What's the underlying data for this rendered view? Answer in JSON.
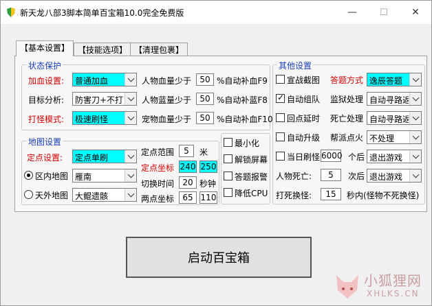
{
  "window": {
    "title": "新天龙八部3脚本简单百宝箱10.0完全免费版",
    "minimize": "—",
    "maximize": "☐",
    "close": "✕"
  },
  "tabs": [
    {
      "label": "【基本设置】",
      "active": true
    },
    {
      "label": "【技能选项】",
      "active": false
    },
    {
      "label": "【清理包裹】",
      "active": false
    }
  ],
  "status_protect": {
    "title": "状态保护",
    "rows": [
      {
        "label": "加血设置:",
        "combo": "普通加血",
        "desc": "人物血量少于",
        "value": "50",
        "suffix": "%自动补血F9"
      },
      {
        "label": "目标分析:",
        "combo": "防害刀+不打对",
        "desc": "人物蓝量少于",
        "value": "50",
        "suffix": "%自动补蓝F8"
      },
      {
        "label": "打怪模式:",
        "combo": "极速刷怪",
        "desc": "宠物血量少于",
        "value": "50",
        "suffix": "%自动补血F10"
      }
    ]
  },
  "map_settings": {
    "title": "地图设置",
    "point_label": "定点设置:",
    "point_combo": "定点单刷",
    "range_label": "定点范围",
    "range_value": "5",
    "range_unit": "米",
    "coord_label": "定点坐标",
    "coord_x": "240",
    "coord_y": "250",
    "switch_label": "切换时间",
    "switch_value": "20",
    "switch_unit": "秒钟",
    "two_label": "两点坐标",
    "two_x": "65",
    "two_y": "110",
    "inner_map_label": "区内地图",
    "inner_map_combo": "雁南",
    "outer_map_label": "天外地图",
    "outer_map_combo": "大鲲遗骸"
  },
  "misc_checks": [
    "最小化",
    "解锁屏幕",
    "答题报警",
    "降低CPU"
  ],
  "other_settings": {
    "title": "其他设置",
    "rows": [
      {
        "check": "宣战截图",
        "checked": false,
        "label": "答题方式",
        "label_red": true,
        "combo": "逸辰答题",
        "combo_cyan": true
      },
      {
        "check": "自动组队",
        "checked": true,
        "label": "监狱处理",
        "label_red": false,
        "combo": "自动寻路返回",
        "combo_cyan": false
      },
      {
        "check": "回点延时",
        "checked": false,
        "label": "死亡处理",
        "label_red": false,
        "combo": "自动寻路返回",
        "combo_cyan": false
      },
      {
        "check": "自动升级",
        "checked": false,
        "label": "帮派点火",
        "label_red": false,
        "combo": "不处理",
        "combo_cyan": false
      }
    ],
    "daily_check": "当日刷怪",
    "daily_value": "6000",
    "daily_after": "个后",
    "daily_combo": "退出游戏",
    "death_label": "人物死亡:",
    "death_value": "5",
    "death_after": "次后",
    "death_combo": "退出游戏",
    "kill_label": "打死换怪:",
    "kill_value": "15",
    "kill_suffix": "秒内(怪物不死换怪)"
  },
  "start_button": "启动百宝箱",
  "watermark": {
    "text": "小狐狸网",
    "url": "XHLKS.CN"
  },
  "colors": {
    "group_title": "#1a3fb8",
    "label_red": "#d80000",
    "highlight": "#00ffff"
  }
}
